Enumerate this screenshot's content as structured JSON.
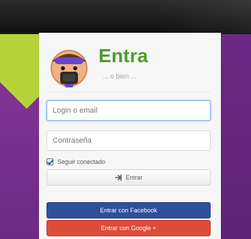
{
  "header": {
    "title": "Entra",
    "subtitle": "... o bien ..."
  },
  "form": {
    "login_placeholder": "Login o email",
    "password_placeholder": "Contraseña",
    "remember_label": "Seguir conectado",
    "submit_label": "Entrar",
    "facebook_label": "Entrar con Facebook",
    "google_label": "Entrar con Google +"
  },
  "colors": {
    "accent_green": "#4b9d2a",
    "facebook_blue": "#2f4f98",
    "google_red": "#de4b3a",
    "background_purple": "#7a2f8f",
    "lime_corner": "#b6d23b"
  },
  "icons": {
    "avatar": "character-avatar",
    "enter": "enter-icon",
    "remember": "checkbox-checked"
  }
}
